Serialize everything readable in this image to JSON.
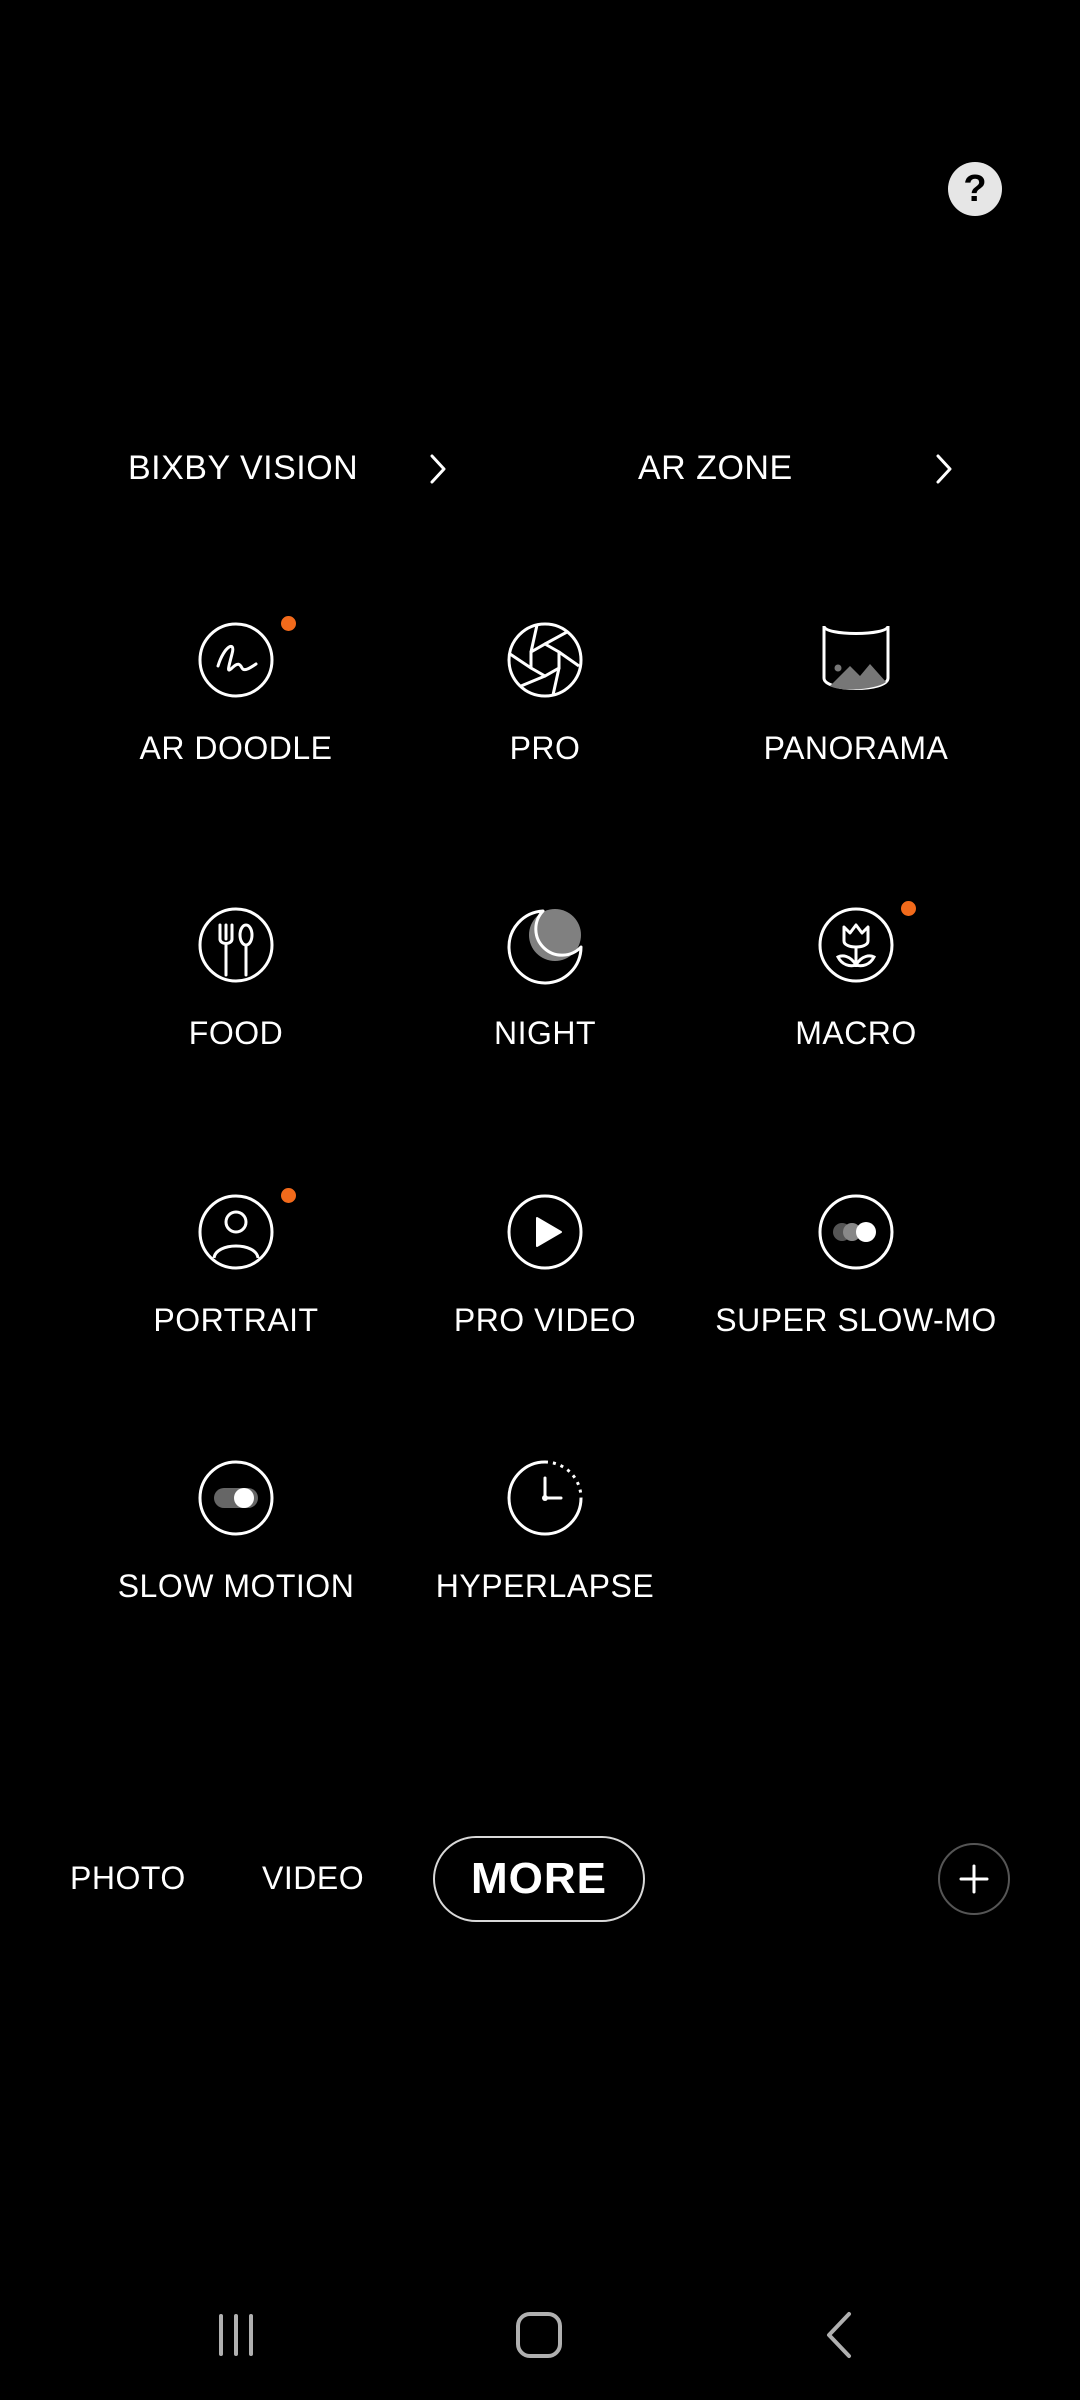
{
  "top_links": [
    {
      "label": "BIXBY VISION",
      "icon": "chevron-right-icon"
    },
    {
      "label": "AR ZONE",
      "icon": "chevron-right-icon"
    }
  ],
  "help": {
    "icon": "help-icon",
    "glyph": "?"
  },
  "modes": [
    {
      "label": "AR DOODLE",
      "icon": "ar-doodle-icon",
      "new": true
    },
    {
      "label": "PRO",
      "icon": "aperture-icon",
      "new": false
    },
    {
      "label": "PANORAMA",
      "icon": "panorama-icon",
      "new": false
    },
    {
      "label": "FOOD",
      "icon": "food-icon",
      "new": false
    },
    {
      "label": "NIGHT",
      "icon": "moon-icon",
      "new": false
    },
    {
      "label": "MACRO",
      "icon": "flower-icon",
      "new": true
    },
    {
      "label": "PORTRAIT",
      "icon": "portrait-icon",
      "new": true
    },
    {
      "label": "PRO VIDEO",
      "icon": "play-icon",
      "new": false
    },
    {
      "label": "SUPER SLOW-MO",
      "icon": "super-slow-mo-icon",
      "new": false
    },
    {
      "label": "SLOW MOTION",
      "icon": "slow-motion-icon",
      "new": false
    },
    {
      "label": "HYPERLAPSE",
      "icon": "hyperlapse-icon",
      "new": false
    }
  ],
  "bottom_tabs": {
    "photo": "PHOTO",
    "video": "VIDEO",
    "more": "MORE"
  },
  "colors": {
    "background": "#000000",
    "new_dot": "#f26a1b",
    "text": "#ffffff"
  }
}
